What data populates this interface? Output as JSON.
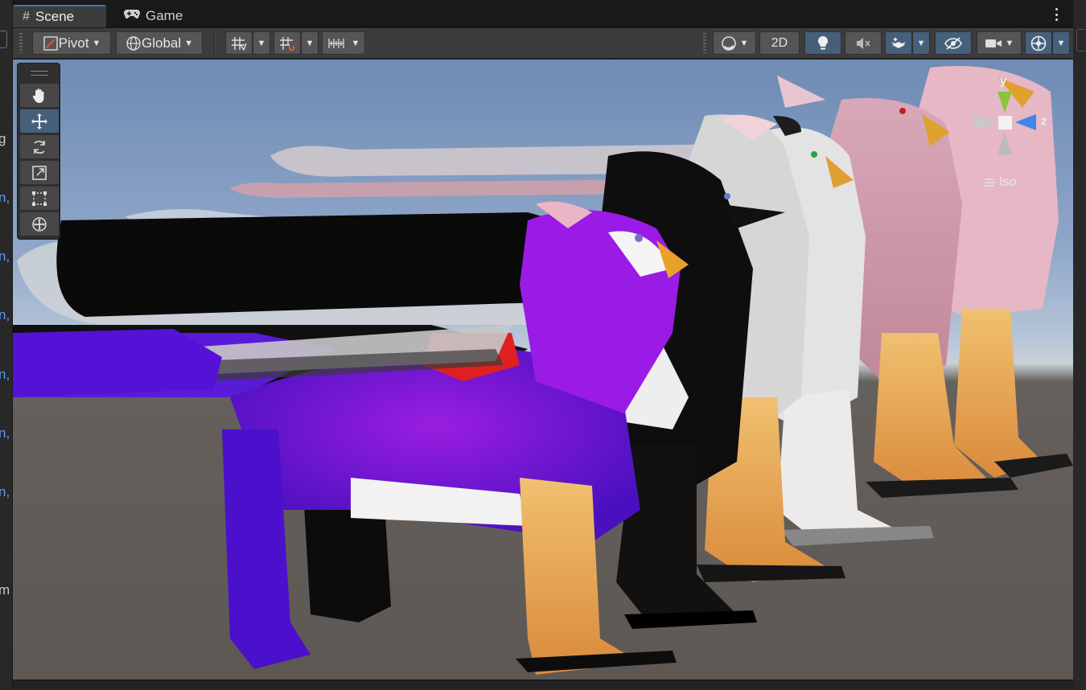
{
  "tabs": [
    {
      "label": "Scene",
      "icon": "grid-hash-icon",
      "active": true
    },
    {
      "label": "Game",
      "icon": "gamepad-icon",
      "active": false
    }
  ],
  "toolbar": {
    "pivot_label": "Pivot",
    "global_label": "Global",
    "mode_2d_label": "2D"
  },
  "left_panel": {
    "fragments": [
      "g",
      "n,",
      "n,",
      "n,",
      "n,",
      "n,",
      "n,",
      "",
      "m"
    ]
  },
  "gizmo": {
    "y_label": "y",
    "z_label": "z",
    "projection_label": "Iso"
  },
  "colors": {
    "accent": "#3a79bb",
    "toggle_on": "#46607c",
    "gizmo_y": "#8ac43f",
    "gizmo_z": "#3f86e8",
    "axis_text_blue": "#5b9bf0"
  }
}
